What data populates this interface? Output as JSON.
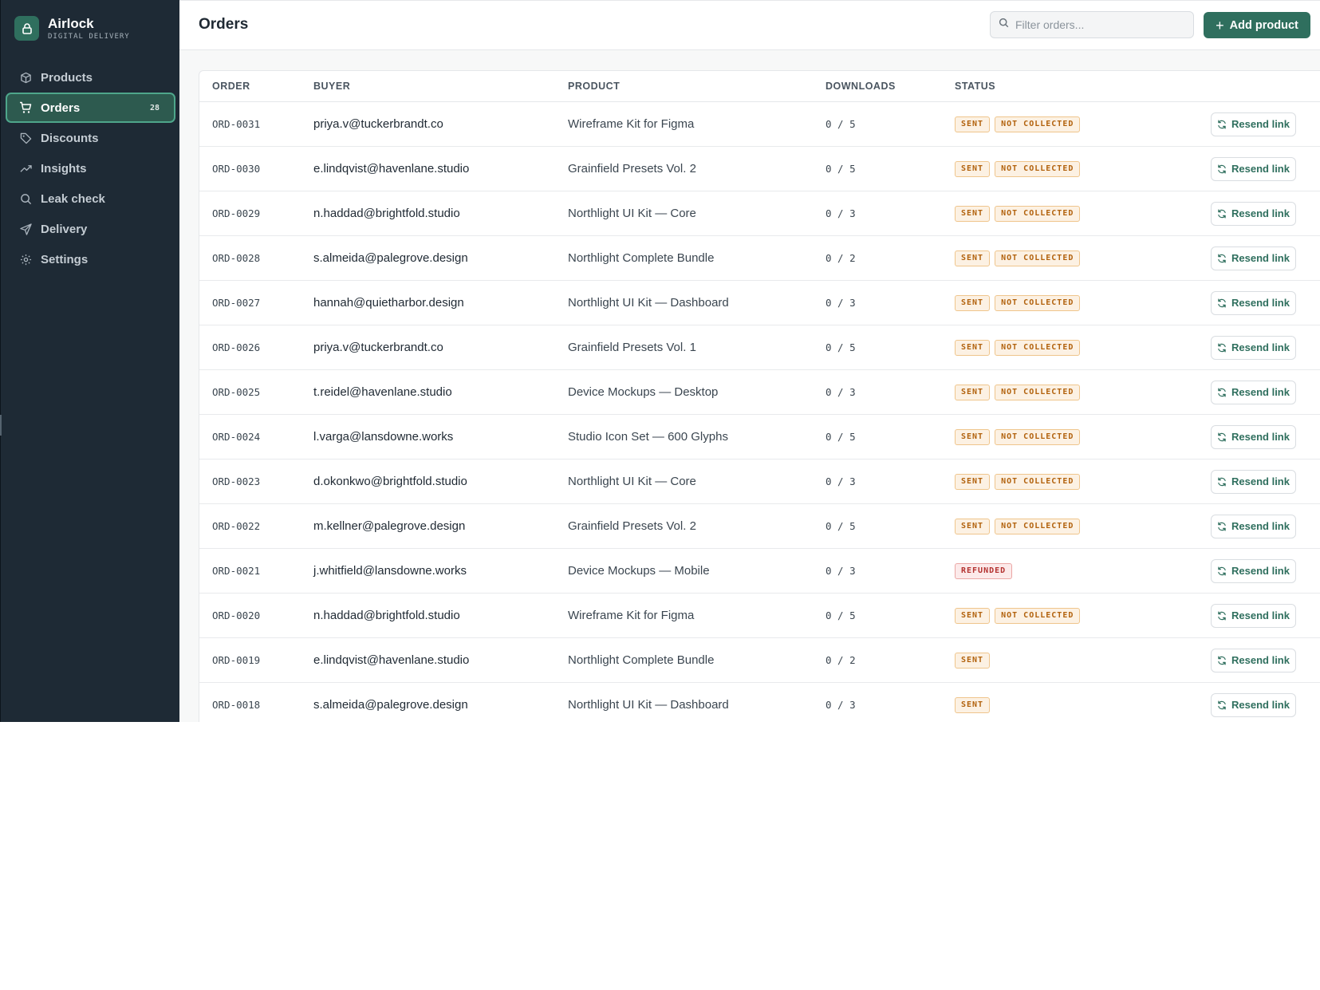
{
  "brand": {
    "name": "Airlock",
    "subtitle": "DIGITAL DELIVERY",
    "logo_icon": "lock-icon"
  },
  "sidebar": {
    "items": [
      {
        "label": "Products",
        "icon": "box-icon"
      },
      {
        "label": "Orders",
        "icon": "cart-icon",
        "badge": "28",
        "active": true
      },
      {
        "label": "Discounts",
        "icon": "tag-icon"
      },
      {
        "label": "Insights",
        "icon": "trending-icon"
      },
      {
        "label": "Leak check",
        "icon": "search-icon"
      },
      {
        "label": "Delivery",
        "icon": "send-icon"
      },
      {
        "label": "Settings",
        "icon": "gear-icon"
      }
    ]
  },
  "header": {
    "title": "Orders",
    "search_placeholder": "Filter orders...",
    "add_button": "Add product"
  },
  "table": {
    "columns": [
      "ORDER",
      "BUYER",
      "PRODUCT",
      "DOWNLOADS",
      "STATUS"
    ],
    "action_label": "Resend link",
    "rows": [
      {
        "order": "ORD-0031",
        "buyer": "priya.v@tuckerbrandt.co",
        "product": "Wireframe Kit for Figma",
        "downloads": "0 / 5",
        "status": [
          "SENT",
          "NOT COLLECTED"
        ]
      },
      {
        "order": "ORD-0030",
        "buyer": "e.lindqvist@havenlane.studio",
        "product": "Grainfield Presets Vol. 2",
        "downloads": "0 / 5",
        "status": [
          "SENT",
          "NOT COLLECTED"
        ]
      },
      {
        "order": "ORD-0029",
        "buyer": "n.haddad@brightfold.studio",
        "product": "Northlight UI Kit — Core",
        "downloads": "0 / 3",
        "status": [
          "SENT",
          "NOT COLLECTED"
        ]
      },
      {
        "order": "ORD-0028",
        "buyer": "s.almeida@palegrove.design",
        "product": "Northlight Complete Bundle",
        "downloads": "0 / 2",
        "status": [
          "SENT",
          "NOT COLLECTED"
        ]
      },
      {
        "order": "ORD-0027",
        "buyer": "hannah@quietharbor.design",
        "product": "Northlight UI Kit — Dashboard",
        "downloads": "0 / 3",
        "status": [
          "SENT",
          "NOT COLLECTED"
        ]
      },
      {
        "order": "ORD-0026",
        "buyer": "priya.v@tuckerbrandt.co",
        "product": "Grainfield Presets Vol. 1",
        "downloads": "0 / 5",
        "status": [
          "SENT",
          "NOT COLLECTED"
        ]
      },
      {
        "order": "ORD-0025",
        "buyer": "t.reidel@havenlane.studio",
        "product": "Device Mockups — Desktop",
        "downloads": "0 / 3",
        "status": [
          "SENT",
          "NOT COLLECTED"
        ]
      },
      {
        "order": "ORD-0024",
        "buyer": "l.varga@lansdowne.works",
        "product": "Studio Icon Set — 600 Glyphs",
        "downloads": "0 / 5",
        "status": [
          "SENT",
          "NOT COLLECTED"
        ]
      },
      {
        "order": "ORD-0023",
        "buyer": "d.okonkwo@brightfold.studio",
        "product": "Northlight UI Kit — Core",
        "downloads": "0 / 3",
        "status": [
          "SENT",
          "NOT COLLECTED"
        ]
      },
      {
        "order": "ORD-0022",
        "buyer": "m.kellner@palegrove.design",
        "product": "Grainfield Presets Vol. 2",
        "downloads": "0 / 5",
        "status": [
          "SENT",
          "NOT COLLECTED"
        ]
      },
      {
        "order": "ORD-0021",
        "buyer": "j.whitfield@lansdowne.works",
        "product": "Device Mockups — Mobile",
        "downloads": "0 / 3",
        "status": [
          "REFUNDED"
        ]
      },
      {
        "order": "ORD-0020",
        "buyer": "n.haddad@brightfold.studio",
        "product": "Wireframe Kit for Figma",
        "downloads": "0 / 5",
        "status": [
          "SENT",
          "NOT COLLECTED"
        ]
      },
      {
        "order": "ORD-0019",
        "buyer": "e.lindqvist@havenlane.studio",
        "product": "Northlight Complete Bundle",
        "downloads": "0 / 2",
        "status": [
          "SENT"
        ]
      },
      {
        "order": "ORD-0018",
        "buyer": "s.almeida@palegrove.design",
        "product": "Northlight UI Kit — Dashboard",
        "downloads": "0 / 3",
        "status": [
          "SENT"
        ]
      }
    ]
  },
  "colors": {
    "sidebar_bg": "#1e2a35",
    "accent": "#2f6f5e",
    "badge_warn_text": "#b2620d",
    "badge_danger_text": "#b3312f"
  }
}
